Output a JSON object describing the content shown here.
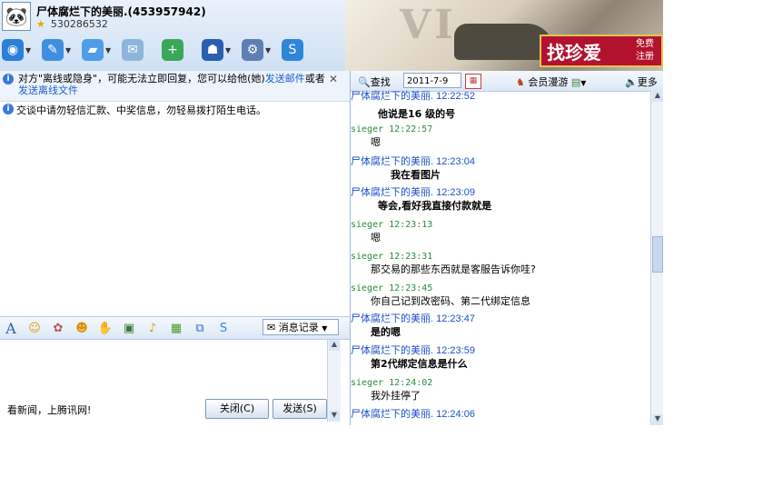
{
  "window": {
    "title": "尸体腐烂下的美丽.(453957942)",
    "qq_number": "530286532"
  },
  "ad": {
    "main": "找珍爱",
    "side_line1": "免费",
    "side_line2": "注册"
  },
  "toolbar": {
    "items": [
      {
        "name": "video-call-button",
        "icon": "video-icon",
        "color": "#2c7fd6"
      },
      {
        "name": "voice-call-button",
        "icon": "microphone-icon",
        "color": "#3f8fe0"
      },
      {
        "name": "send-file-button",
        "icon": "folder-icon",
        "color": "#4f9de6"
      },
      {
        "name": "send-sms-button",
        "icon": "mail-icon",
        "color": "#6fa6d8"
      },
      {
        "name": "create-group-button",
        "icon": "add-icon",
        "color": "#3aa858"
      },
      {
        "name": "police-button",
        "icon": "police-icon",
        "color": "#2a5fb0"
      },
      {
        "name": "apps-button",
        "icon": "gear-icon",
        "color": "#5c7fb4"
      },
      {
        "name": "soso-button",
        "icon": "soso-icon",
        "color": "#2e86d9"
      }
    ]
  },
  "notice": {
    "text_part1": "对方\"离线或隐身\"，可能无法立即回复，您可以给他(她)",
    "link1": "发送邮件",
    "text_part2": "或者",
    "link2": "发送离线文件"
  },
  "warning": {
    "text": "交谈中请勿轻信汇款、中奖信息，勿轻易拨打陌生电话。"
  },
  "format_toolbar": {
    "history_label": "消息记录"
  },
  "bottom": {
    "news_text": "看新闻，上腾讯网!",
    "close_label": "关闭(C)",
    "send_label": "发送(S)"
  },
  "right_toolbar": {
    "find_label": "查找",
    "date_value": "2011-7-9",
    "member_label": "会员漫游",
    "more_label": "更多"
  },
  "messages": [
    {
      "sender": "尸体腐烂下的美丽",
      "time": "12:22:52",
      "kind": "remote",
      "text": ""
    },
    {
      "sender": "",
      "time": "",
      "kind": "body",
      "text": "他说是16 级的号",
      "bold": true
    },
    {
      "sender": "sieger",
      "time": "12:22:57",
      "kind": "self",
      "text": "嗯"
    },
    {
      "sender": "尸体腐烂下的美丽",
      "time": "12:23:04",
      "kind": "remote",
      "text": "我在看图片",
      "bold": true
    },
    {
      "sender": "尸体腐烂下的美丽",
      "time": "12:23:09",
      "kind": "remote",
      "text": "等会,看好我直接付款就是",
      "bold": true
    },
    {
      "sender": "sieger",
      "time": "12:23:13",
      "kind": "self",
      "text": "嗯"
    },
    {
      "sender": "sieger",
      "time": "12:23:31",
      "kind": "self",
      "text": "那交易的那些东西就是客服告诉你哇?"
    },
    {
      "sender": "sieger",
      "time": "12:23:45",
      "kind": "self",
      "text": "你自己记到改密码、第二代绑定信息"
    },
    {
      "sender": "尸体腐烂下的美丽",
      "time": "12:23:47",
      "kind": "remote",
      "text": "是的嗯",
      "bold": true
    },
    {
      "sender": "尸体腐烂下的美丽",
      "time": "12:23:59",
      "kind": "remote",
      "text": "第2代绑定信息是什么",
      "bold": true
    },
    {
      "sender": "sieger",
      "time": "12:24:02",
      "kind": "self",
      "text": "我外挂停了"
    },
    {
      "sender": "尸体腐烂下的美丽",
      "time": "12:24:06",
      "kind": "remote",
      "text": ""
    }
  ]
}
